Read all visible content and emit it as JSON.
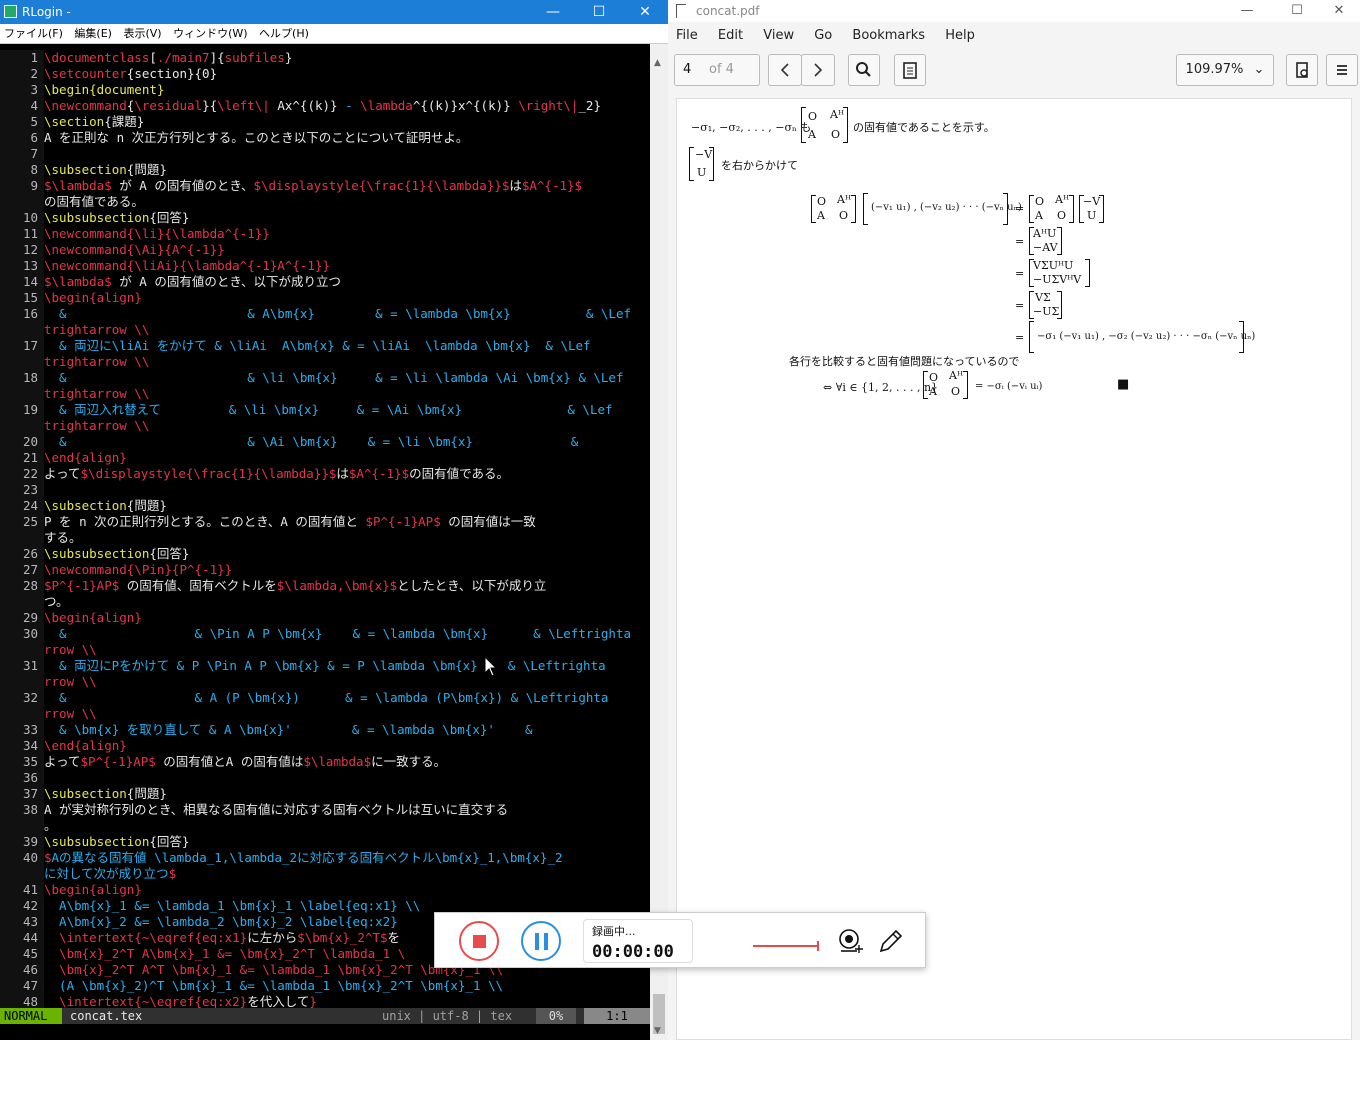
{
  "left_window": {
    "title": "RLogin -",
    "menu": [
      "ファイル(F)",
      "編集(E)",
      "表示(V)",
      "ウィンドウ(W)",
      "ヘルプ(H)"
    ]
  },
  "editor_lines": [
    {
      "n": "1",
      "s": [
        [
          "r",
          "\\documentclass"
        ],
        [
          "w",
          "["
        ],
        [
          "r",
          "./main7"
        ],
        [
          "w",
          "]{"
        ],
        [
          "r",
          "subfiles"
        ],
        [
          "w",
          "}"
        ]
      ]
    },
    {
      "n": "2",
      "s": [
        [
          "r",
          "\\setcounter"
        ],
        [
          "w",
          "{section}{0}"
        ]
      ]
    },
    {
      "n": "3",
      "s": [
        [
          "y",
          "\\begin{document}"
        ]
      ]
    },
    {
      "n": "4",
      "s": [
        [
          "r",
          "\\newcommand"
        ],
        [
          "w",
          "{"
        ],
        [
          "r",
          "\\residual"
        ],
        [
          "w",
          "}{"
        ],
        [
          "r",
          "\\left\\|"
        ],
        [
          "w",
          " Ax^{(k)} "
        ],
        [
          "b",
          "-"
        ],
        [
          "w",
          " "
        ],
        [
          "r",
          "\\lambda"
        ],
        [
          "w",
          "^{(k)}x^{(k)} "
        ],
        [
          "r",
          "\\right\\|"
        ],
        [
          "w",
          "_2}"
        ]
      ]
    },
    {
      "n": "5",
      "s": [
        [
          "y",
          "\\section"
        ],
        [
          "w",
          "{課題}"
        ]
      ]
    },
    {
      "n": "6",
      "s": [
        [
          "w",
          "A を正則な n 次正方行列とする。このとき以下のことについて証明せよ。"
        ]
      ]
    },
    {
      "n": "7",
      "s": []
    },
    {
      "n": "8",
      "s": [
        [
          "y",
          "\\subsection"
        ],
        [
          "w",
          "{問題}"
        ]
      ]
    },
    {
      "n": "9",
      "s": [
        [
          "r",
          "$\\lambda$"
        ],
        [
          "w",
          " が A の固有値のとき、"
        ],
        [
          "r",
          "$\\displaystyle{\\frac{1}{\\lambda}}$"
        ],
        [
          "w",
          "は"
        ],
        [
          "r",
          "$A^{-1}$"
        ]
      ]
    },
    {
      "n": "",
      "s": [
        [
          "w",
          "の固有値である。"
        ]
      ]
    },
    {
      "n": "10",
      "s": [
        [
          "y",
          "\\subsubsection"
        ],
        [
          "w",
          "{回答}"
        ]
      ]
    },
    {
      "n": "11",
      "s": [
        [
          "r",
          "\\newcommand{\\li}{\\lambda^{-1}}"
        ]
      ]
    },
    {
      "n": "12",
      "s": [
        [
          "r",
          "\\newcommand{\\Ai}{A^{-1}}"
        ]
      ]
    },
    {
      "n": "13",
      "s": [
        [
          "r",
          "\\newcommand{\\liAi}{\\lambda^{-1}A^{-1}}"
        ]
      ]
    },
    {
      "n": "14",
      "s": [
        [
          "r",
          "$\\lambda$"
        ],
        [
          "w",
          " が A の固有値のとき、以下が成り立つ"
        ]
      ]
    },
    {
      "n": "15",
      "s": [
        [
          "r",
          "\\begin{align}"
        ]
      ]
    },
    {
      "n": "16",
      "s": [
        [
          "b",
          "  &                        & A\\bm{x}        & = \\lambda \\bm{x}          & \\Lef"
        ]
      ]
    },
    {
      "n": "",
      "s": [
        [
          "r",
          "trightarrow \\\\"
        ]
      ]
    },
    {
      "n": "17",
      "s": [
        [
          "b",
          "  & 両辺に\\liAi をかけて & \\liAi  A\\bm{x} & = \\liAi  \\lambda \\bm{x}  & \\Lef"
        ]
      ]
    },
    {
      "n": "",
      "s": [
        [
          "r",
          "trightarrow \\\\"
        ]
      ]
    },
    {
      "n": "18",
      "s": [
        [
          "b",
          "  &                        & \\li \\bm{x}     & = \\li \\lambda \\Ai \\bm{x} & \\Lef"
        ]
      ]
    },
    {
      "n": "",
      "s": [
        [
          "r",
          "trightarrow \\\\"
        ]
      ]
    },
    {
      "n": "19",
      "s": [
        [
          "b",
          "  & 両辺入れ替えて         & \\li \\bm{x}     & = \\Ai \\bm{x}              & \\Lef"
        ]
      ]
    },
    {
      "n": "",
      "s": [
        [
          "r",
          "trightarrow \\\\"
        ]
      ]
    },
    {
      "n": "20",
      "s": [
        [
          "b",
          "  &                        & \\Ai \\bm{x}    & = \\li \\bm{x}             &"
        ]
      ]
    },
    {
      "n": "21",
      "s": [
        [
          "r",
          "\\end{align}"
        ]
      ]
    },
    {
      "n": "22",
      "s": [
        [
          "w",
          "よって"
        ],
        [
          "r",
          "$\\displaystyle{\\frac{1}{\\lambda}}$"
        ],
        [
          "w",
          "は"
        ],
        [
          "r",
          "$A^{-1}$"
        ],
        [
          "w",
          "の固有値である。"
        ]
      ]
    },
    {
      "n": "23",
      "s": []
    },
    {
      "n": "24",
      "s": [
        [
          "y",
          "\\subsection"
        ],
        [
          "w",
          "{問題}"
        ]
      ]
    },
    {
      "n": "25",
      "s": [
        [
          "w",
          "P を n 次の正則行列とする。このとき、A の固有値と "
        ],
        [
          "r",
          "$P^{-1}AP$"
        ],
        [
          "w",
          " の固有値は一致"
        ]
      ]
    },
    {
      "n": "",
      "s": [
        [
          "w",
          "する。"
        ]
      ]
    },
    {
      "n": "26",
      "s": [
        [
          "y",
          "\\subsubsection"
        ],
        [
          "w",
          "{回答}"
        ]
      ]
    },
    {
      "n": "27",
      "s": [
        [
          "r",
          "\\newcommand{\\Pin}{P^{-1}}"
        ]
      ]
    },
    {
      "n": "28",
      "s": [
        [
          "r",
          "$P^{-1}AP$"
        ],
        [
          "w",
          " の固有値、固有ベクトルを"
        ],
        [
          "r",
          "$\\lambda,\\bm{x}$"
        ],
        [
          "w",
          "としたとき、以下が成り立"
        ]
      ]
    },
    {
      "n": "",
      "s": [
        [
          "w",
          "つ。"
        ]
      ]
    },
    {
      "n": "29",
      "s": [
        [
          "r",
          "\\begin{align}"
        ]
      ]
    },
    {
      "n": "30",
      "s": [
        [
          "b",
          "  &                 & \\Pin A P \\bm{x}    & = \\lambda \\bm{x}      & \\Leftrighta"
        ]
      ]
    },
    {
      "n": "",
      "s": [
        [
          "r",
          "rrow \\\\"
        ]
      ]
    },
    {
      "n": "31",
      "s": [
        [
          "b",
          "  & 両辺にPをかけて & P \\Pin A P \\bm{x} & = P \\lambda \\bm{x}    & \\Leftrighta"
        ]
      ]
    },
    {
      "n": "",
      "s": [
        [
          "r",
          "rrow \\\\"
        ]
      ]
    },
    {
      "n": "32",
      "s": [
        [
          "b",
          "  &                 & A (P \\bm{x})      & = \\lambda (P\\bm{x}) & \\Leftrighta"
        ]
      ]
    },
    {
      "n": "",
      "s": [
        [
          "r",
          "rrow \\\\"
        ]
      ]
    },
    {
      "n": "33",
      "s": [
        [
          "b",
          "  & \\bm{x} を取り直して & A \\bm{x}'        & = \\lambda \\bm{x}'    &"
        ]
      ]
    },
    {
      "n": "34",
      "s": [
        [
          "r",
          "\\end{align}"
        ]
      ]
    },
    {
      "n": "35",
      "s": [
        [
          "w",
          "よって"
        ],
        [
          "r",
          "$P^{-1}AP$"
        ],
        [
          "w",
          " の固有値とA の固有値は"
        ],
        [
          "r",
          "$\\lambda$"
        ],
        [
          "w",
          "に一致する。"
        ]
      ]
    },
    {
      "n": "36",
      "s": []
    },
    {
      "n": "37",
      "s": [
        [
          "y",
          "\\subsection"
        ],
        [
          "w",
          "{問題}"
        ]
      ]
    },
    {
      "n": "38",
      "s": [
        [
          "w",
          "A が実対称行列のとき、相異なる固有値に対応する固有ベクトルは互いに直交する"
        ]
      ]
    },
    {
      "n": "",
      "s": [
        [
          "w",
          "。"
        ]
      ]
    },
    {
      "n": "39",
      "s": [
        [
          "y",
          "\\subsubsection"
        ],
        [
          "w",
          "{回答}"
        ]
      ]
    },
    {
      "n": "40",
      "s": [
        [
          "r",
          "$"
        ],
        [
          "b",
          "Aの異なる固有値 \\lambda_1,\\lambda_2に対応する固有ベクトル\\bm{x}_1,\\bm{x}_2"
        ]
      ]
    },
    {
      "n": "",
      "s": [
        [
          "b",
          "に対して次が成り立つ"
        ],
        [
          "r",
          "$"
        ]
      ]
    },
    {
      "n": "41",
      "s": [
        [
          "r",
          "\\begin{align}"
        ]
      ]
    },
    {
      "n": "42",
      "s": [
        [
          "b",
          "  A\\bm{x}_1 &= \\lambda_1 \\bm{x}_1 \\label{eq:x1} \\\\"
        ]
      ]
    },
    {
      "n": "43",
      "s": [
        [
          "b",
          "  A\\bm{x}_2 &= \\lambda_2 \\bm{x}_2 \\label{eq:x2}"
        ]
      ]
    },
    {
      "n": "44",
      "s": [
        [
          "r",
          "  \\intertext{~\\eqref{eq:x1}"
        ],
        [
          "w",
          "に左から"
        ],
        [
          "r",
          "$\\bm{x}_2^T$"
        ],
        [
          "w",
          "を"
        ]
      ]
    },
    {
      "n": "45",
      "s": [
        [
          "r",
          "  \\bm{x}_2^T A\\bm{x}_1 &= \\bm{x}_2^T \\lambda_1 \\"
        ]
      ]
    },
    {
      "n": "46",
      "s": [
        [
          "r",
          "  \\bm{x}_2^T A^T \\bm{x}_1 &= \\lambda_1 \\bm{x}_2^T \\bm{x}_1 \\\\"
        ]
      ]
    },
    {
      "n": "47",
      "s": [
        [
          "b",
          "  (A \\bm{x}_2)^T \\bm{x}_1 &= \\lambda_1 \\bm{x}_2^T \\bm{x}_1 \\\\"
        ]
      ]
    },
    {
      "n": "48",
      "s": [
        [
          "r",
          "  \\intertext{~\\eqref{eq:x2}"
        ],
        [
          "w",
          "を代入して"
        ],
        [
          "r",
          "}"
        ]
      ]
    }
  ],
  "status_bar": {
    "mode": "NORMAL",
    "file": "concat.tex",
    "info": "unix | utf-8 | tex",
    "percent": "0%",
    "position": "1:1"
  },
  "right_window": {
    "title": "concat.pdf",
    "menu": [
      "File",
      "Edit",
      "View",
      "Go",
      "Bookmarks",
      "Help"
    ],
    "page_input": "4",
    "page_of": "of 4",
    "zoom": "109.97%"
  },
  "pdf": {
    "l1_pre": "−σ₁, −σ₂, . . . , −σₙ も",
    "l1_post": "の固有値であることを示す。",
    "mat_O": "O",
    "mat_AH": "Aᴴ",
    "mat_A": "A",
    "vec_negV": "−V",
    "vec_U": "U",
    "l2_post": "を右からかけて",
    "eq1_lhs": "(−v₁ u₁) , (−v₂ u₂) · · · (−vₙ uₙ)",
    "r2a": "AᴴU",
    "r2b": "−AV",
    "r3a": "VΣUᴴU",
    "r3b": "−UΣVᴴV",
    "r4a": "VΣ",
    "r4b": "−UΣ",
    "r5": "−σ₁ (−v₁ u₁) , −σ₂ (−v₂ u₂) · · · −σₙ (−vₙ uₙ)",
    "compare": "各行を比較すると固有値問題になっているので",
    "final_pre": "⇔ ∀i ∈ {1, 2, . . . , n}",
    "final_post": "= −σᵢ (−vᵢ uᵢ)",
    "qed": "■"
  },
  "recorder": {
    "label": "録画中...",
    "time": "00:00:00"
  }
}
